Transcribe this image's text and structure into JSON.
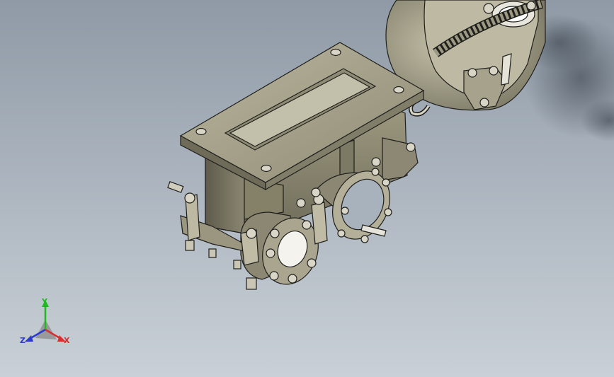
{
  "viewport": {
    "background_top": "#8f9aa6",
    "background_bottom": "#c9d0d7",
    "model_color": "#a9a58f",
    "model_edge_color": "#1f1f1c"
  },
  "triad": {
    "x_label": "X",
    "y_label": "Y",
    "z_label": "Z",
    "x_color": "#d83030",
    "y_color": "#22b822",
    "z_color": "#2c3ad0"
  }
}
